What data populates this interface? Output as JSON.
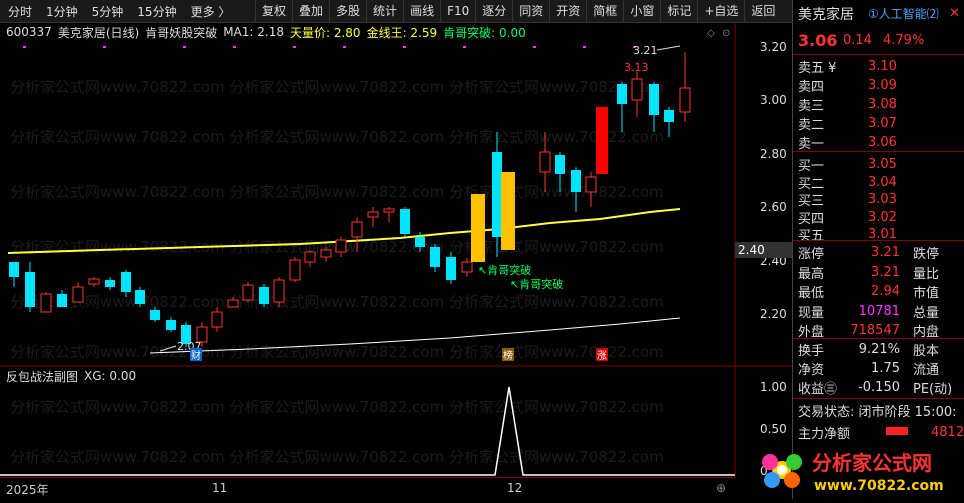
{
  "toolbar": {
    "left_items": [
      "分时",
      "1分钟",
      "5分钟",
      "15分钟",
      "更多 〉"
    ],
    "right_items": [
      "复权",
      "叠加",
      "多股",
      "统计",
      "画线",
      "F10",
      "逐分",
      "同资",
      "开资",
      "简框",
      "小窗",
      "标记",
      "+自选",
      "返回"
    ]
  },
  "infobar": {
    "code": "600337",
    "name": "美克家居(日线)",
    "indicator": "肯哥妖股突破",
    "ma1": "MA1: 2.18",
    "tianliang": "天量价: 2.80",
    "jinxian": "金线王: 2.59",
    "breakout": "肯哥突破: 0.00"
  },
  "price_axis": [
    "3.20",
    "3.00",
    "2.80",
    "2.60",
    "2.40",
    "2.20"
  ],
  "current_price_tag": "2.40",
  "annotations": {
    "high": "3.21",
    "high2": "3.13",
    "low": "2.07",
    "breakout1": "肯哥突破",
    "breakout2": "肯哥突破",
    "cai": "财",
    "bang": "榜",
    "zhang": "涨"
  },
  "sub_chart": {
    "title": "反包战法副图",
    "xg": "XG: 0.00",
    "axis": [
      "1.00",
      "0.50",
      "0.00"
    ]
  },
  "time_axis": [
    "2025年",
    "11",
    "12"
  ],
  "right_panel": {
    "title": "美克家居",
    "tag": "①人工智能⑵",
    "price": "3.06",
    "change": "0.14",
    "pct": "4.79%",
    "asks": [
      {
        "label": "卖五 ¥",
        "price": "3.10"
      },
      {
        "label": "卖四",
        "price": "3.09"
      },
      {
        "label": "卖三",
        "price": "3.08"
      },
      {
        "label": "卖二",
        "price": "3.07"
      },
      {
        "label": "卖一",
        "price": "3.06"
      }
    ],
    "bids": [
      {
        "label": "买一",
        "price": "3.05"
      },
      {
        "label": "买二",
        "price": "3.04"
      },
      {
        "label": "买三",
        "price": "3.03"
      },
      {
        "label": "买四",
        "price": "3.02"
      },
      {
        "label": "买五",
        "price": "3.01"
      }
    ],
    "stats": [
      {
        "l1": "涨停",
        "v1": "3.21",
        "l2": "跌停"
      },
      {
        "l1": "最高",
        "v1": "3.21",
        "l2": "量比"
      },
      {
        "l1": "最低",
        "v1": "2.94",
        "l2": "市值"
      },
      {
        "l1": "现量",
        "v1": "10781",
        "l2": "总量"
      },
      {
        "l1": "外盘",
        "v1": "718547",
        "l2": "内盘"
      }
    ],
    "stats2": [
      {
        "l1": "换手",
        "v1": "9.21%",
        "l2": "股本"
      },
      {
        "l1": "净资",
        "v1": "1.75",
        "l2": "流通"
      },
      {
        "l1": "收益㊂",
        "v1": "-0.150",
        "l2": "PE(动)"
      }
    ],
    "status": "交易状态: 闭市阶段 15:00:",
    "main_flow_label": "主力净额",
    "main_flow_value": "4812"
  },
  "logo_text": "分析家公式网",
  "logo_url": "www.70822.com",
  "colors": {
    "up": "#ff3333",
    "down": "#00e5ff",
    "yellow": "#ffff44",
    "white": "#ffffff"
  }
}
